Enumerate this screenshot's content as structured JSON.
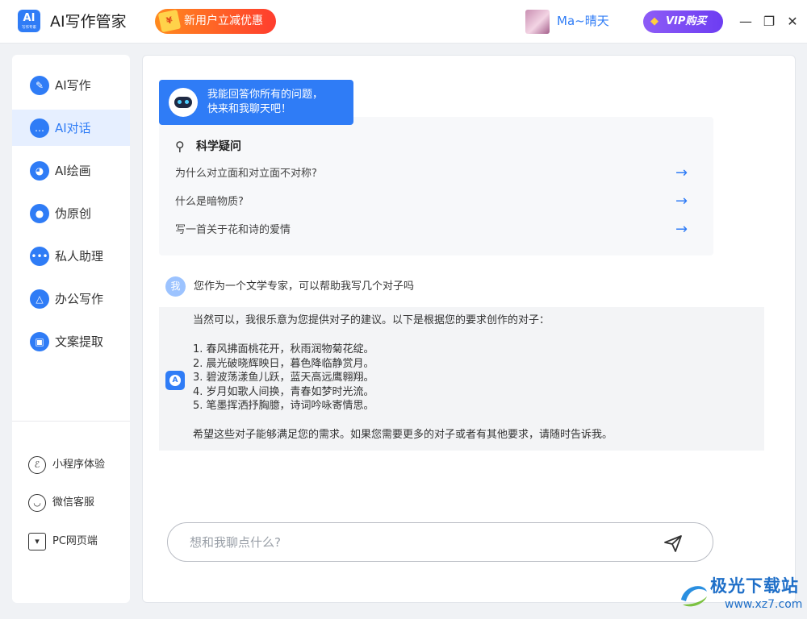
{
  "app": {
    "logo_text": "AI",
    "logo_sub": "写作专家",
    "title": "AI写作管家",
    "promo_label": "新用户立减优惠",
    "promo_icon": "gift-coupon-icon",
    "username": "Ma~晴天",
    "vip_label": "VIP购买",
    "window_controls": [
      "minimize-icon",
      "maximize-icon",
      "close-icon"
    ],
    "accent_color": "#2f7cf6"
  },
  "sidebar": {
    "items": [
      {
        "label": "AI写作",
        "icon": "pen-icon",
        "active": false
      },
      {
        "label": "AI对话",
        "icon": "chat-bubble-icon",
        "active": true
      },
      {
        "label": "AI绘画",
        "icon": "palette-icon",
        "active": false
      },
      {
        "label": "伪原创",
        "icon": "bulb-icon",
        "active": false
      },
      {
        "label": "私人助理",
        "icon": "assistant-chat-icon",
        "active": false
      },
      {
        "label": "办公写作",
        "icon": "office-icon",
        "active": false
      },
      {
        "label": "文案提取",
        "icon": "extract-icon",
        "active": false
      }
    ],
    "bottom": [
      {
        "label": "小程序体验",
        "icon": "mini-program-icon"
      },
      {
        "label": "微信客服",
        "icon": "wechat-service-icon"
      },
      {
        "label": "PC网页端",
        "icon": "pc-web-icon"
      }
    ]
  },
  "chat": {
    "greeting_line1": "我能回答你所有的问题，",
    "greeting_line2": "快来和我聊天吧！",
    "card": {
      "title": "科学疑问",
      "questions": [
        "为什么对立面和对立面不对称?",
        "什么是暗物质?",
        "写一首关于花和诗的爱情"
      ]
    },
    "user_avatar_text": "我",
    "user_message": "您作为一个文学专家，可以帮助我写几个对子吗",
    "reply": {
      "intro": "当然可以，我很乐意为您提供对子的建议。以下是根据您的要求创作的对子：",
      "items": [
        "1. 春风拂面桃花开，秋雨润物菊花绽。",
        "2. 晨光破晓辉映日，暮色降临静赏月。",
        "3. 碧波荡漾鱼儿跃，蓝天高远鹰翱翔。",
        "4. 岁月如歌人间换，青春如梦时光流。",
        "5. 笔墨挥洒抒胸臆，诗词吟咏寄情思。"
      ],
      "outro": "希望这些对子能够满足您的需求。如果您需要更多的对子或者有其他要求，请随时告诉我。"
    },
    "input_placeholder": "想和我聊点什么?",
    "input_value": ""
  },
  "watermark": {
    "brand": "极光下载站",
    "url": "www.xz7.com"
  }
}
